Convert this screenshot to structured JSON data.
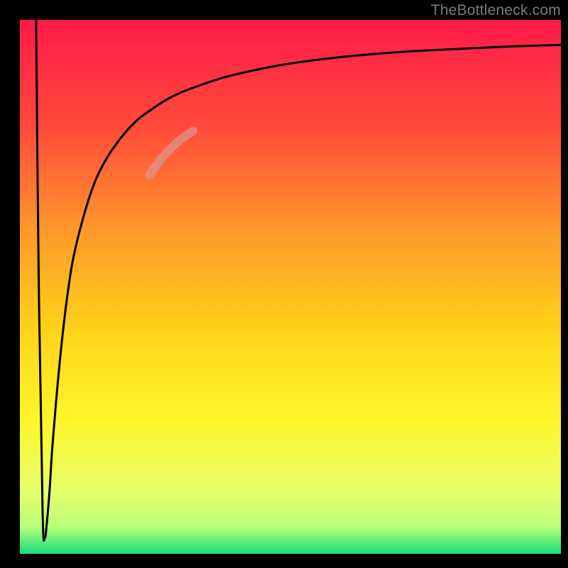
{
  "watermark": "TheBottleneck.com",
  "chart_data": {
    "type": "line",
    "title": "",
    "xlabel": "",
    "ylabel": "",
    "xlim": [
      0,
      100
    ],
    "ylim": [
      0,
      100
    ],
    "legend": "none",
    "grid": false,
    "background": "heatmap-gradient",
    "gradient_stops": [
      {
        "offset": 0.0,
        "color": "#ff1a4a"
      },
      {
        "offset": 0.2,
        "color": "#ff4a3a"
      },
      {
        "offset": 0.4,
        "color": "#ff9a2a"
      },
      {
        "offset": 0.58,
        "color": "#ffd21a"
      },
      {
        "offset": 0.75,
        "color": "#fff62a"
      },
      {
        "offset": 0.88,
        "color": "#e8ff6a"
      },
      {
        "offset": 0.95,
        "color": "#b8ff7a"
      },
      {
        "offset": 1.0,
        "color": "#16e07a"
      }
    ],
    "annotations": [
      {
        "text": "TheBottleneck.com",
        "position": "top-right",
        "color": "#7a7a7a"
      }
    ],
    "series": [
      {
        "name": "bottleneck-curve",
        "color": "#000000",
        "x": [
          3.0,
          3.5,
          4.2,
          4.6,
          5.0,
          5.5,
          6.0,
          7.0,
          8.0,
          9.0,
          10.0,
          12.0,
          14.0,
          16.0,
          18.0,
          20.0,
          22.0,
          24.0,
          27.0,
          30.0,
          34.0,
          38.0,
          43.0,
          48.0,
          54.0,
          62.0,
          72.0,
          82.0,
          90.0,
          96.0,
          100.0
        ],
        "values": [
          100,
          50,
          8,
          3,
          6,
          12,
          20,
          32,
          42,
          50,
          56,
          64,
          70,
          74,
          77,
          79.5,
          81.5,
          83,
          85,
          86.5,
          88,
          89.3,
          90.5,
          91.5,
          92.4,
          93.3,
          94.1,
          94.6,
          95.0,
          95.2,
          95.3
        ]
      },
      {
        "name": "highlight-segment",
        "color": "#d79a9a",
        "stroke_width": 12,
        "x": [
          24.0,
          25.0,
          26.0,
          27.0,
          28.0,
          29.0,
          30.0,
          31.0,
          32.0
        ],
        "values": [
          71.0,
          72.5,
          73.8,
          75.0,
          76.0,
          77.0,
          77.8,
          78.5,
          79.2
        ]
      }
    ]
  }
}
